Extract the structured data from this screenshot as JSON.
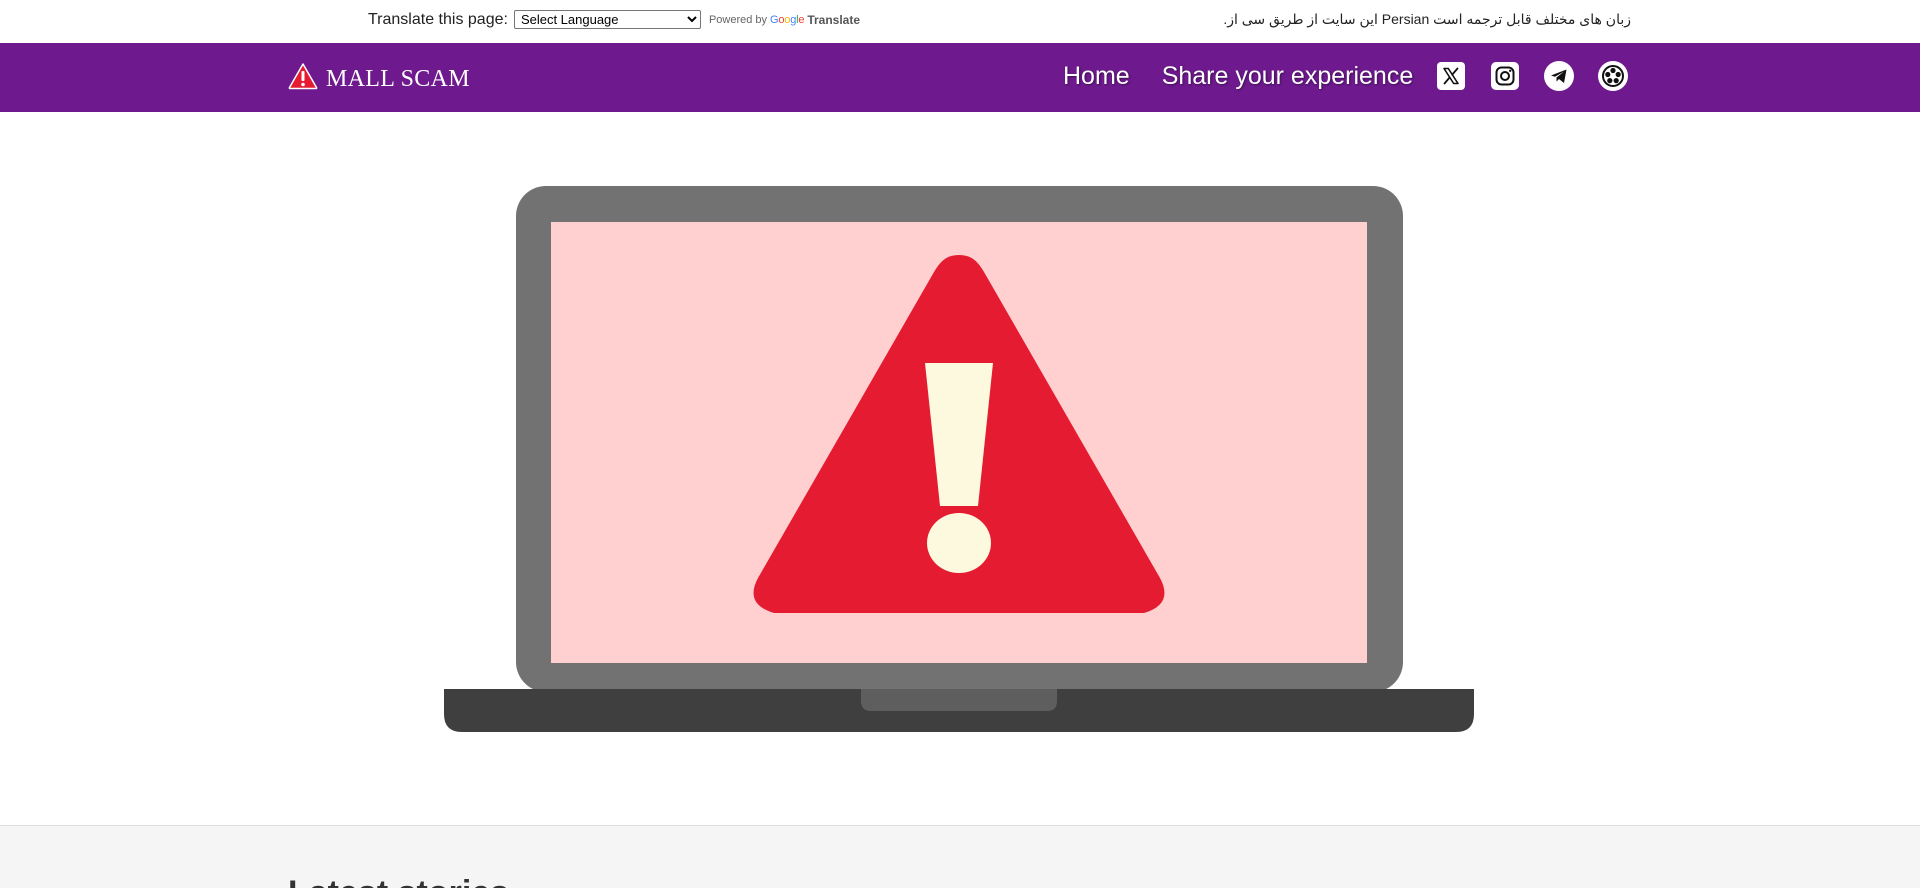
{
  "translate": {
    "label": "Translate this page:",
    "select_value": "Select Language",
    "powered_by": "Powered by",
    "google": "Google",
    "translate_word": "Translate",
    "persian_note": ".ﺍﻳﻦ ﺳﺎﻳﺖ ﺍﺯ ﻃﺮﯾﻖ ﺳﯽ ﺍﺯ Persian ﺯﺑﺎﻥ ﻫﺎﯼ ﻣﺨﺘﻠﻒ ﻗﺎﺑﻞ ﺗﺮﺟﻤﻪ ﺍﺳﺖ"
  },
  "nav": {
    "brand": "MALL SCAM",
    "links": [
      "Home",
      "Share your experience"
    ],
    "social_icons": [
      "x-icon",
      "instagram-icon",
      "telegram-icon",
      "reels-icon"
    ]
  },
  "hero": {
    "image": "laptop-warning-illustration"
  },
  "latest": {
    "title": "Latest stories"
  },
  "colors": {
    "nav_bg": "#6e1a8e",
    "warning_red": "#e51c31",
    "screen_pink": "#ffd0cf",
    "laptop_frame": "#727272",
    "laptop_base": "#3f3f3f"
  }
}
